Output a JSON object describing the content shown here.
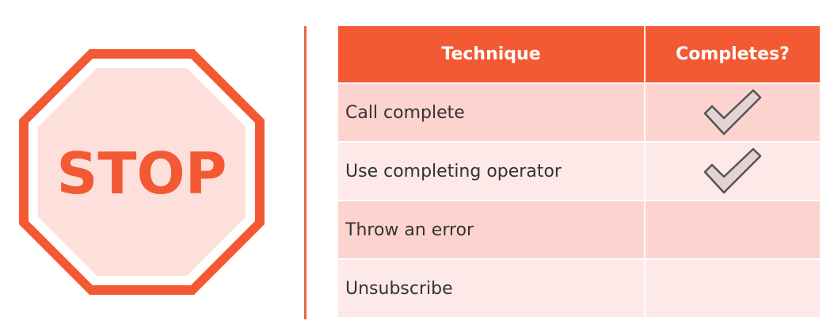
{
  "stop_sign": {
    "text": "STOP",
    "icon": "stop-sign-icon",
    "colors": {
      "outer": "#f35a34",
      "inner_ring": "#ffffff",
      "fill": "#fde0dc",
      "text": "#f35a34"
    }
  },
  "table": {
    "headers": {
      "technique": "Technique",
      "completes": "Completes?"
    },
    "rows": [
      {
        "technique": "Call complete",
        "completes": true
      },
      {
        "technique": "Use completing operator",
        "completes": true
      },
      {
        "technique": "Throw an error",
        "completes": false
      },
      {
        "technique": "Unsubscribe",
        "completes": false
      }
    ],
    "colors": {
      "header_bg": "#f35a34",
      "row_odd": "#fdd3d0",
      "row_even": "#fde9e8",
      "check_fill": "#e3d4d3",
      "check_stroke": "#555555"
    }
  },
  "divider_color": "#e8643f"
}
